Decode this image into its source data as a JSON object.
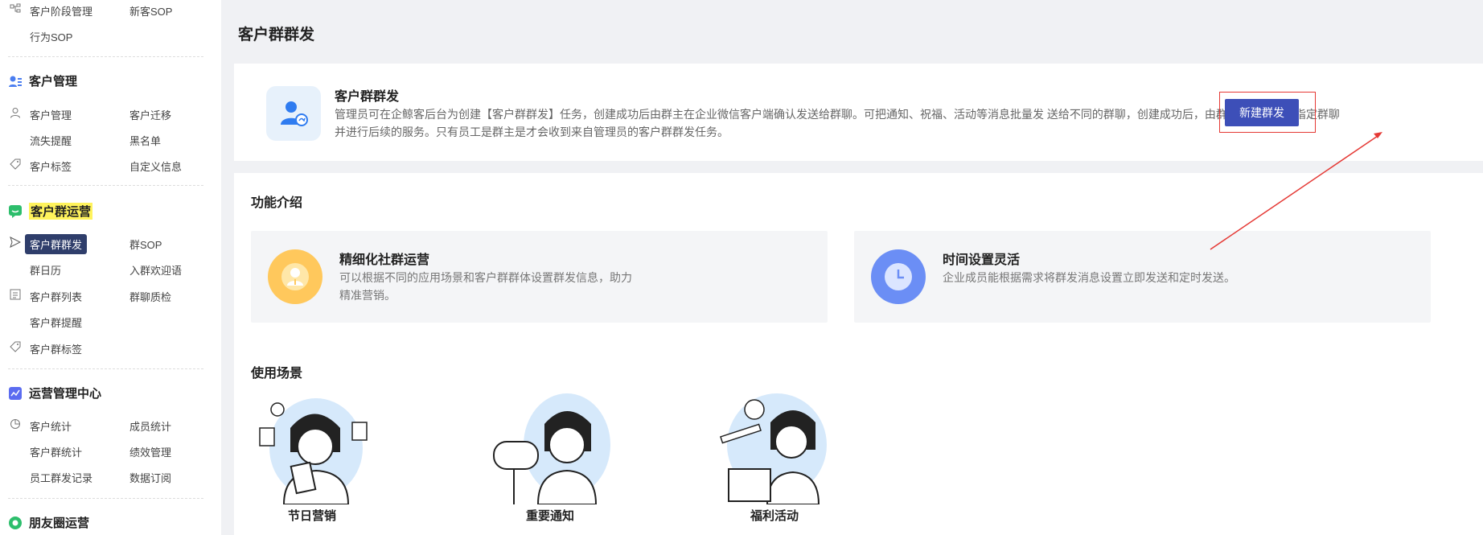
{
  "sidebar": {
    "top_items": {
      "c1": "客户阶段管理",
      "c2": "新客SOP",
      "c3": "行为SOP"
    },
    "customer_mgmt": {
      "title": "客户管理",
      "items": [
        "客户管理",
        "客户迁移",
        "流失提醒",
        "黑名单",
        "客户标签",
        "自定义信息"
      ]
    },
    "group_ops": {
      "title": "客户群运营",
      "items": [
        "客户群群发",
        "群SOP",
        "群日历",
        "入群欢迎语",
        "客户群列表",
        "群聊质检",
        "客户群提醒",
        "客户群标签"
      ]
    },
    "ops_center": {
      "title": "运营管理中心",
      "items": [
        "客户统计",
        "成员统计",
        "客户群统计",
        "绩效管理",
        "员工群发记录",
        "数据订阅"
      ]
    },
    "moments": {
      "title": "朋友圈运营"
    }
  },
  "page": {
    "title": "客户群群发"
  },
  "intro": {
    "title": "客户群群发",
    "desc": "管理员可在企鲸客后台为创建【客户群群发】任务，创建成功后由群主在企业微信客户端确认发送给群聊。可把通知、祝福、活动等消息批量发 送给不同的群聊，创建成功后，由群主选择发送给指定群聊并进行后续的服务。只有员工是群主是才会收到来自管理员的客户群群发任务。",
    "button": "新建群发"
  },
  "features": {
    "title": "功能介绍",
    "items": [
      {
        "title": "精细化社群运营",
        "desc": "可以根据不同的应用场景和客户群群体设置群发信息，助力精准营销。",
        "color": "#ffc85c"
      },
      {
        "title": "时间设置灵活",
        "desc": "企业成员能根据需求将群发消息设置立即发送和定时发送。",
        "color": "#6b8ef5"
      }
    ]
  },
  "scenarios": {
    "title": "使用场景",
    "items": [
      {
        "label": "节日营销"
      },
      {
        "label": "重要通知"
      },
      {
        "label": "福利活动"
      }
    ]
  },
  "colors": {
    "accent": "#3d4fb8",
    "highlight": "#fff35c",
    "annotation": "#e53935"
  }
}
